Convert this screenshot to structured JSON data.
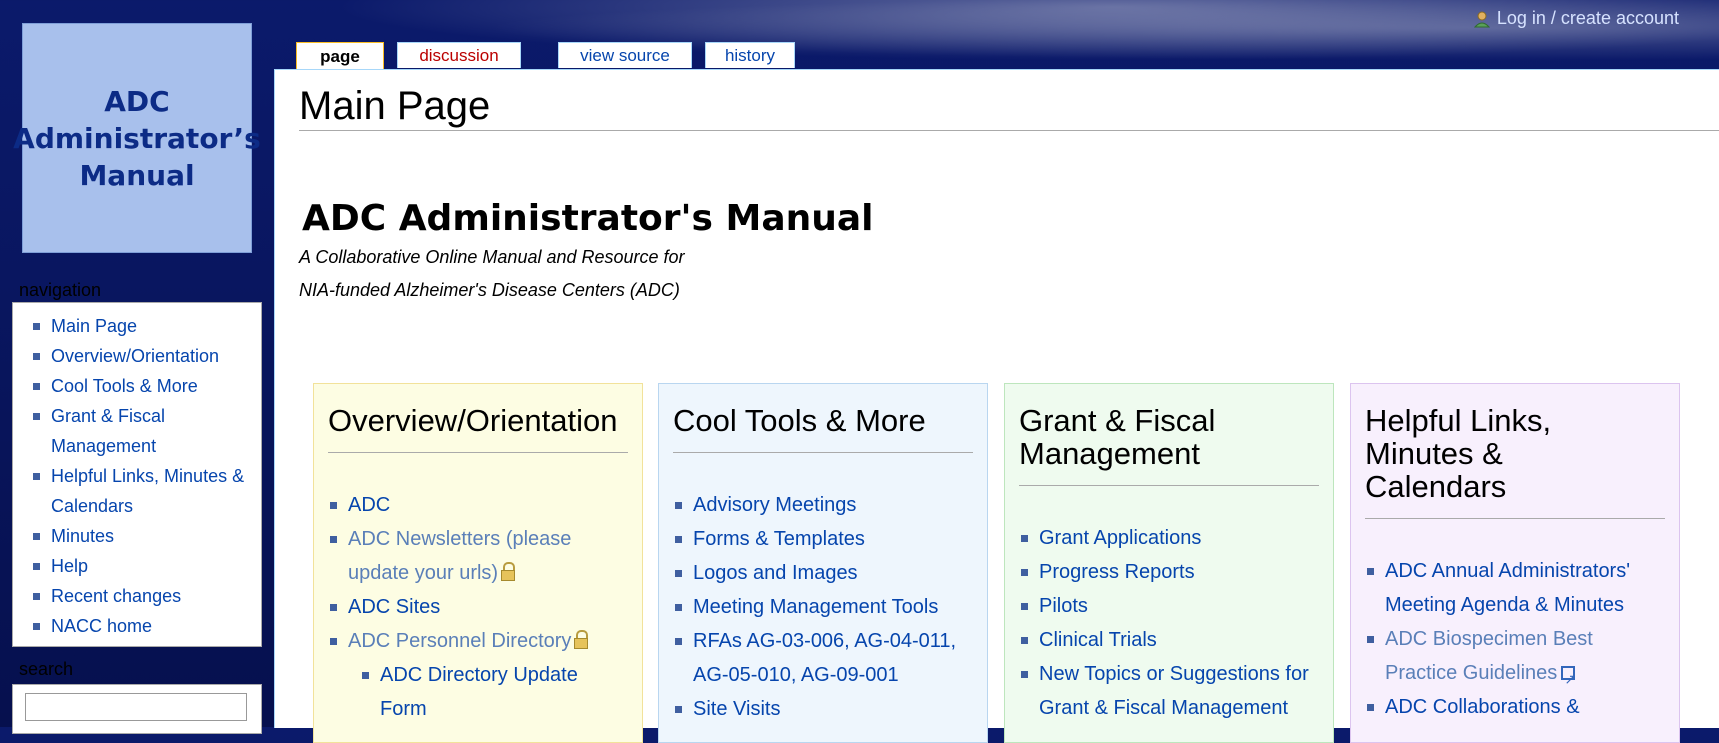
{
  "logo": {
    "lines": [
      "ADC",
      "Administrator’s",
      "Manual"
    ]
  },
  "user": {
    "login_label": "Log in / create account"
  },
  "tabs": [
    {
      "label": "page"
    },
    {
      "label": "discussion"
    },
    {
      "label": "view source"
    },
    {
      "label": "history"
    }
  ],
  "navigation": {
    "title": "navigation",
    "items": [
      {
        "label": "Main Page"
      },
      {
        "label": "Overview/Orientation"
      },
      {
        "label": "Cool Tools & More"
      },
      {
        "label": "Grant & Fiscal Management"
      },
      {
        "label": "Helpful Links, Minutes & Calendars"
      },
      {
        "label": "Minutes"
      },
      {
        "label": "Help"
      },
      {
        "label": "Recent changes"
      },
      {
        "label": "NACC home"
      }
    ]
  },
  "search": {
    "title": "search",
    "placeholder": ""
  },
  "page": {
    "heading": "Main Page",
    "title": "ADC Administrator's Manual",
    "subtitle_lines": [
      "A Collaborative Online Manual and Resource for",
      "NIA-funded Alzheimer's Disease Centers (ADC)"
    ]
  },
  "boxes": [
    {
      "title_lines": [
        "Overview/Orientation"
      ],
      "bg": "#fdfde3",
      "border": "#f2e29a",
      "items": [
        {
          "label": "ADC"
        },
        {
          "label": "ADC Newsletters (please update your urls)",
          "lock": true
        },
        {
          "label": "ADC Sites"
        },
        {
          "label": "ADC Personnel Directory",
          "lock": true
        },
        {
          "label": "ADC Directory Update Form",
          "sub": true
        }
      ]
    },
    {
      "title_lines": [
        "Cool Tools & More"
      ],
      "bg": "#eef6fd",
      "border": "#b9d6f0",
      "items": [
        {
          "label": "Advisory Meetings"
        },
        {
          "label": "Forms & Templates"
        },
        {
          "label": "Logos and Images"
        },
        {
          "label": "Meeting Management Tools"
        },
        {
          "label": "RFAs AG-03-006, AG-04-011, AG-05-010, AG-09-001"
        },
        {
          "label": "Site Visits"
        }
      ]
    },
    {
      "title_lines": [
        "Grant & Fiscal",
        "Management"
      ],
      "bg": "#effbef",
      "border": "#bde6bd",
      "items": [
        {
          "label": "Grant Applications"
        },
        {
          "label": "Progress Reports"
        },
        {
          "label": "Pilots"
        },
        {
          "label": "Clinical Trials"
        },
        {
          "label": "New Topics or Suggestions for Grant & Fiscal Management"
        }
      ]
    },
    {
      "title_lines": [
        "Helpful Links,",
        "Minutes &",
        "Calendars"
      ],
      "bg": "#f8f0fd",
      "border": "#dcc4ef",
      "items": [
        {
          "label": "ADC Annual Administrators' Meeting Agenda & Minutes"
        },
        {
          "label": "ADC Biospecimen Best Practice Guidelines",
          "ext": true
        },
        {
          "label": "ADC Collaborations &"
        }
      ]
    }
  ]
}
